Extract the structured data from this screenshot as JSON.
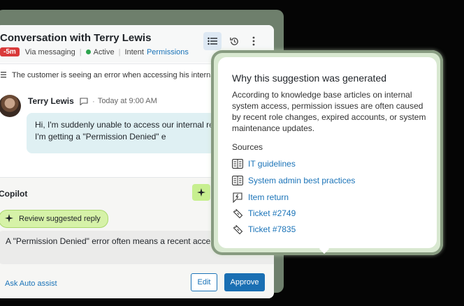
{
  "conversation": {
    "title": "Conversation with Terry Lewis",
    "badge": "-5m",
    "channel": "Via messaging",
    "status": "Active",
    "intent_label": "Intent",
    "intent_value": "Permissions",
    "summary": "The customer is seeing an error when accessing his internal p",
    "message": {
      "sender": "Terry Lewis",
      "time": "Today at 9:00 AM",
      "text": "Hi, I'm suddenly unable to access our internal re dashboard. I'm getting a \"Permission Denied\" e"
    }
  },
  "copilot": {
    "label": "Copilot",
    "review_label": "Review suggested reply",
    "suggestion": "A \"Permission Denied\" error often means a recent acce account issue.",
    "auto_assist": "Ask Auto assist",
    "edit_label": "Edit",
    "approve_label": "Approve"
  },
  "popover": {
    "title": "Why this suggestion was generated",
    "body": "According to knowledge base articles on internal system access, permission issues are often caused by recent role changes, expired accounts, or system maintenance updates.",
    "sources_label": "Sources",
    "sources": [
      {
        "label": "IT guidelines",
        "icon": "article-icon"
      },
      {
        "label": "System admin best practices",
        "icon": "article-icon"
      },
      {
        "label": "Item return",
        "icon": "macro-icon"
      },
      {
        "label": "Ticket #2749",
        "icon": "ticket-icon"
      },
      {
        "label": "Ticket #7835",
        "icon": "ticket-icon"
      }
    ]
  },
  "colors": {
    "accent": "#1a73b8",
    "badge": "#d93a3a",
    "active": "#2da44e",
    "copilot_green": "#c7ef8f",
    "frame": "#6e7f6c"
  }
}
